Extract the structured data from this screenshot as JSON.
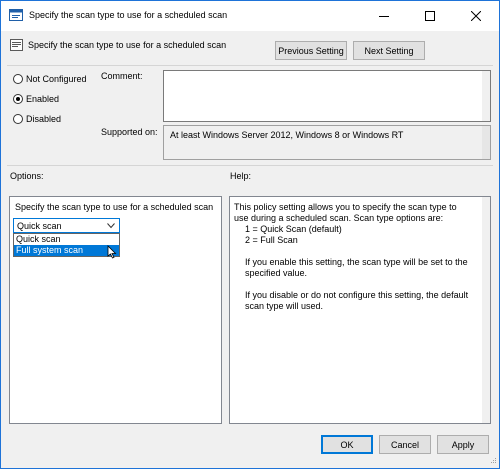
{
  "window": {
    "title": "Specify the scan type to use for a scheduled scan",
    "setting_name": "Specify the scan type to use for a scheduled scan",
    "icon": "policy-setting-icon"
  },
  "nav": {
    "previous": "Previous Setting",
    "next": "Next Setting"
  },
  "state": {
    "not_configured": "Not Configured",
    "enabled": "Enabled",
    "disabled": "Disabled",
    "selected": "enabled"
  },
  "comment": {
    "label": "Comment:",
    "value": ""
  },
  "supported": {
    "label": "Supported on:",
    "value": "At least Windows Server 2012, Windows 8 or Windows RT"
  },
  "options": {
    "header": "Options:",
    "field_label": "Specify the scan type to use for a scheduled scan",
    "selected_value": "Quick scan",
    "list": [
      "Quick scan",
      "Full system scan"
    ],
    "highlighted_index": 1
  },
  "help": {
    "header": "Help:",
    "lines": [
      "This policy setting allows you to specify the scan type to use during a scheduled scan. Scan type options are:",
      "1 = Quick Scan (default)",
      "2 = Full Scan",
      "If you enable this setting, the scan type will be set to the specified value.",
      "If you disable or do not configure this setting, the default scan type will used."
    ]
  },
  "footer": {
    "ok": "OK",
    "cancel": "Cancel",
    "apply": "Apply"
  },
  "colors": {
    "accent": "#0078d7",
    "window_bg": "#f0f0f0",
    "desktop": "#2b6cb0"
  }
}
